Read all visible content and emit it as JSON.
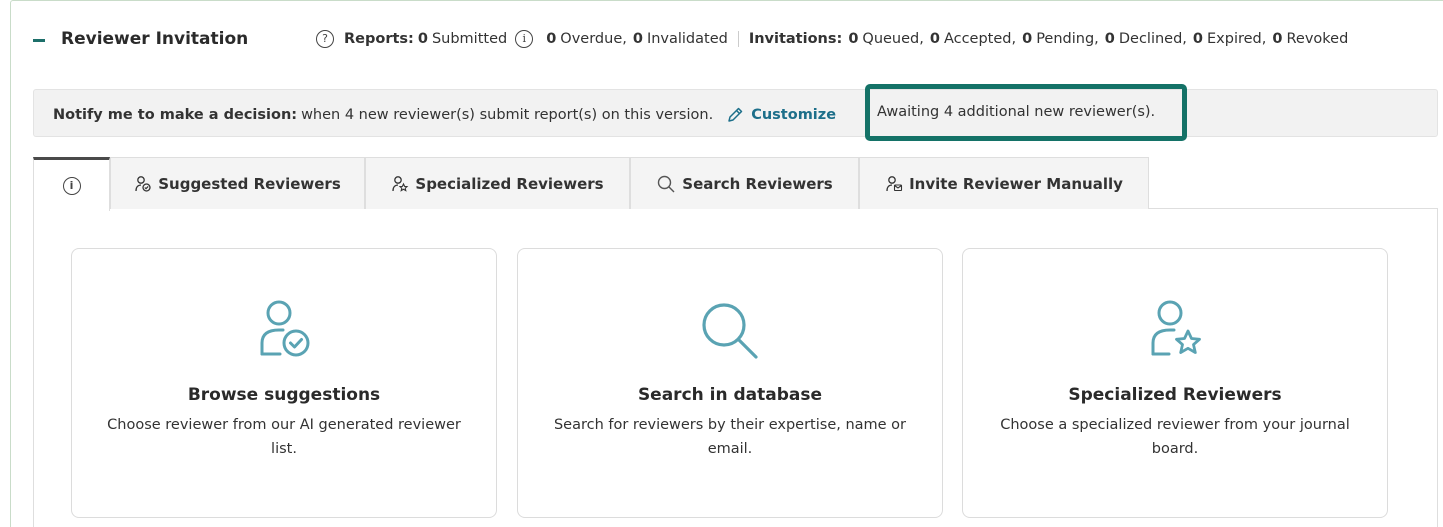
{
  "colors": {
    "accent": "#1d6f8a",
    "highlight_border": "#147267",
    "icon_teal": "#5aa3b3"
  },
  "header": {
    "toggle_icon": "minus-icon",
    "title": "Reviewer Invitation",
    "reports_label": "Reports:",
    "submitted_count": "0",
    "submitted_label": "Submitted",
    "overdue_count": "0",
    "overdue_label": "Overdue,",
    "invalidated_count": "0",
    "invalidated_label": "Invalidated",
    "invitations_label": "Invitations:",
    "queued_count": "0",
    "queued_label": "Queued,",
    "accepted_count": "0",
    "accepted_label": "Accepted,",
    "pending_count": "0",
    "pending_label": "Pending,",
    "declined_count": "0",
    "declined_label": "Declined,",
    "expired_count": "0",
    "expired_label": "Expired,",
    "revoked_count": "0",
    "revoked_label": "Revoked",
    "help_icon": "?",
    "info_icon": "i"
  },
  "notify": {
    "label": "Notify me to make a decision:",
    "text": "when 4 new reviewer(s) submit report(s) on this version.",
    "customize_label": "Customize",
    "awaiting_text": "Awaiting 4 additional new reviewer(s)."
  },
  "tabs": {
    "info_icon": "i",
    "suggested": "Suggested Reviewers",
    "specialized": "Specialized Reviewers",
    "search": "Search Reviewers",
    "manual": "Invite Reviewer Manually"
  },
  "cards": {
    "browse": {
      "title": "Browse suggestions",
      "desc": "Choose reviewer from our AI generated reviewer list."
    },
    "search": {
      "title": "Search in database",
      "desc": "Search for reviewers by their expertise, name or email."
    },
    "special": {
      "title": "Specialized Reviewers",
      "desc": "Choose a specialized reviewer from your journal board."
    }
  }
}
